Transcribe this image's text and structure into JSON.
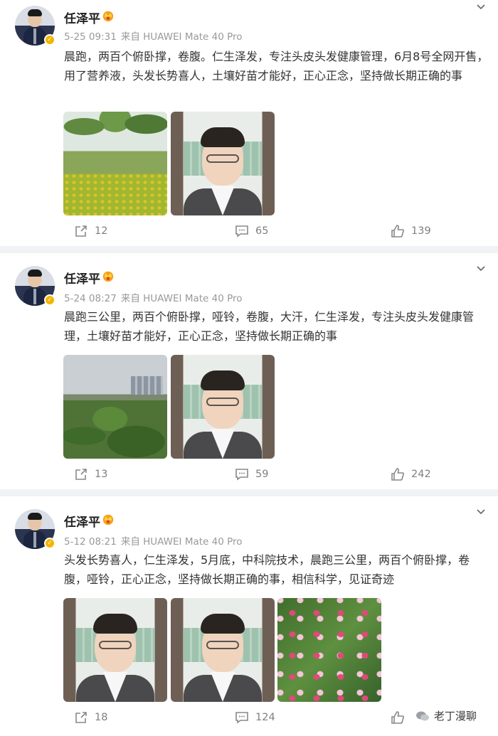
{
  "posts": [
    {
      "author": "任泽平",
      "date": "5-25 09:31",
      "source": "来自 HUAWEI Mate 40 Pro",
      "text": "晨跑，两百个俯卧撑，卷腹。仁生泽发，专注头皮头发健康管理，6月8号全网开售，用了营养液，头发长势喜人，土壤好苗才能好，正心正念，坚持做长期正确的事",
      "images": [
        "park-photo",
        "man-video"
      ],
      "shares": "12",
      "comments": "65",
      "likes": "139"
    },
    {
      "author": "任泽平",
      "date": "5-24 08:27",
      "source": "来自 HUAWEI Mate 40 Pro",
      "text": "晨跑三公里，两百个俯卧撑，哑铃，卷腹，大汗，仁生泽发，专注头皮头发健康管理，土壤好苗才能好，正心正念，坚持做长期正确的事",
      "images": [
        "city-photo",
        "man-video"
      ],
      "shares": "13",
      "comments": "59",
      "likes": "242"
    },
    {
      "author": "任泽平",
      "date": "5-12 08:21",
      "source": "来自 HUAWEI Mate 40 Pro",
      "text": "头发长势喜人，仁生泽发，5月底，中科院技术，晨跑三公里，两百个俯卧撑，卷腹，哑铃，正心正念，坚持做长期正确的事，相信科学，见证奇迹",
      "images": [
        "man-video",
        "man-video",
        "flowers-photo"
      ],
      "shares": "18",
      "comments": "124",
      "likes": ""
    }
  ],
  "watermark": "老丁漫聊",
  "colors": {
    "background": "#f1f2f5",
    "card": "#ffffff",
    "meta": "#999999",
    "verified": "#f5b400"
  }
}
